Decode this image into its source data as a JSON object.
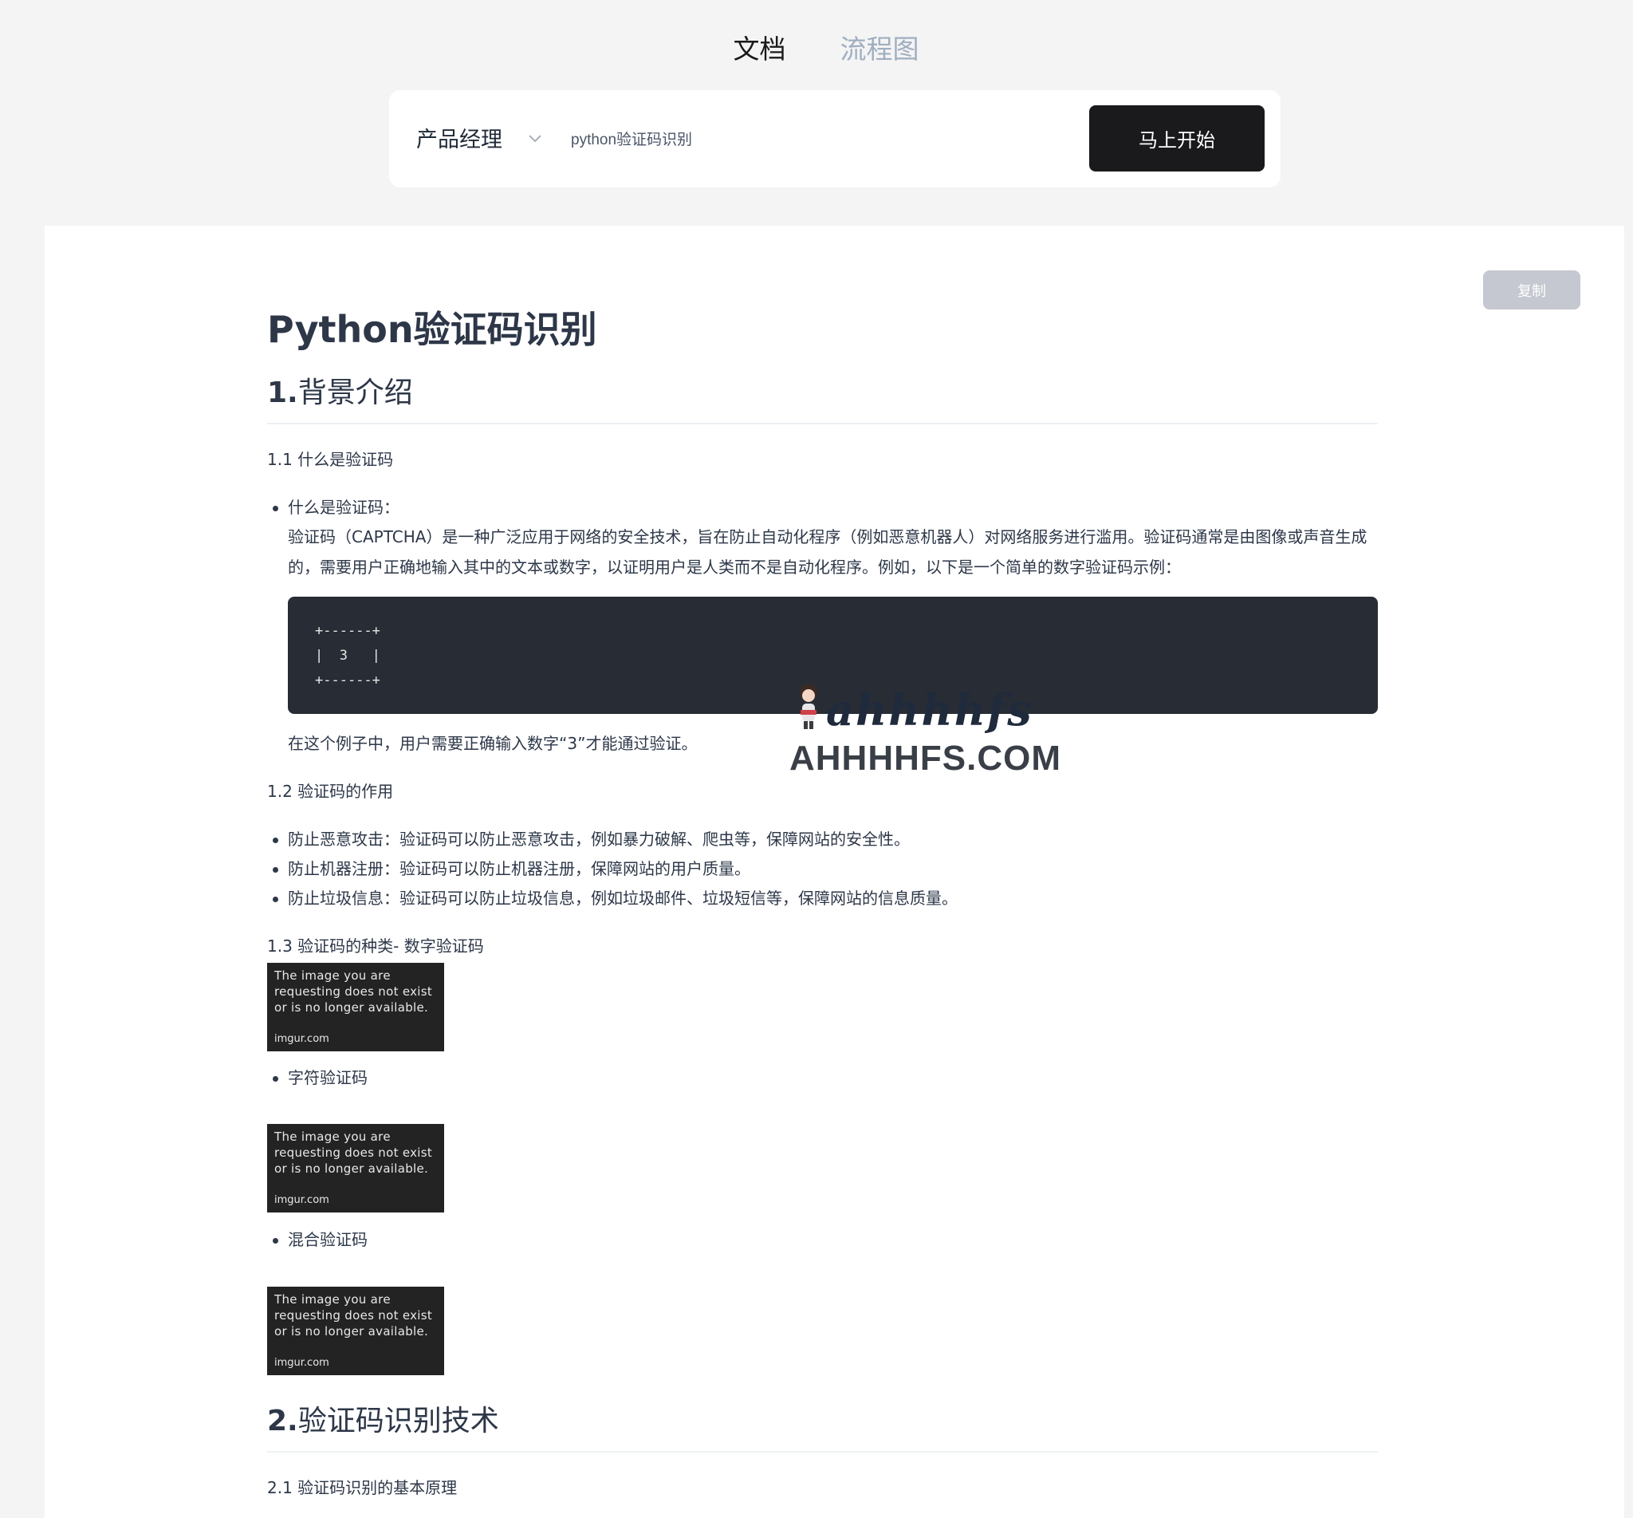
{
  "tabs": [
    {
      "label": "文档",
      "active": true
    },
    {
      "label": "流程图",
      "active": false
    }
  ],
  "search": {
    "role_selected": "产品经理",
    "query_value": "python验证码识别",
    "start_button": "马上开始"
  },
  "toolbar": {
    "copy_label": "复制"
  },
  "doc": {
    "title": "Python验证码识别",
    "section1": {
      "num": "1.",
      "title": "背景介绍"
    },
    "s1_1": "1.1 什么是验证码",
    "s1_1_bullet": "什么是验证码：",
    "s1_1_para": "验证码（CAPTCHA）是一种广泛应用于网络的安全技术，旨在防止自动化程序（例如恶意机器人）对网络服务进行滥用。验证码通常是由图像或声音生成的，需要用户正确地输入其中的文本或数字，以证明用户是人类而不是自动化程序。例如，以下是一个简单的数字验证码示例：",
    "code_lines": [
      "+------+",
      "|  3   |",
      "+------+"
    ],
    "s1_1_after": "在这个例子中，用户需要正确输入数字“3”才能通过验证。",
    "s1_2": "1.2 验证码的作用",
    "s1_2_items": [
      "防止恶意攻击：验证码可以防止恶意攻击，例如暴力破解、爬虫等，保障网站的安全性。",
      "防止机器注册：验证码可以防止机器注册，保障网站的用户质量。",
      "防止垃圾信息：验证码可以防止垃圾信息，例如垃圾邮件、垃圾短信等，保障网站的信息质量。"
    ],
    "s1_3": "1.3 验证码的种类- 数字验证码",
    "s1_3_bullet_char": "字符验证码",
    "s1_3_bullet_mixed": "混合验证码",
    "image_placeholder": {
      "message": [
        "The image you are",
        "requesting does not exist",
        "or is no longer available."
      ],
      "source": "imgur.com"
    },
    "section2": {
      "num": "2.",
      "title": "验证码识别技术"
    },
    "s2_1": "2.1 验证码识别的基本原理"
  },
  "watermark": {
    "script": "ahhhhfs",
    "domain": "AHHHHFS.COM"
  },
  "colors": {
    "accent_dark": "#1a1a1d",
    "code_bg": "#282c34",
    "muted_tab": "#a0aec0",
    "copy_bg": "#c5c8d0"
  }
}
